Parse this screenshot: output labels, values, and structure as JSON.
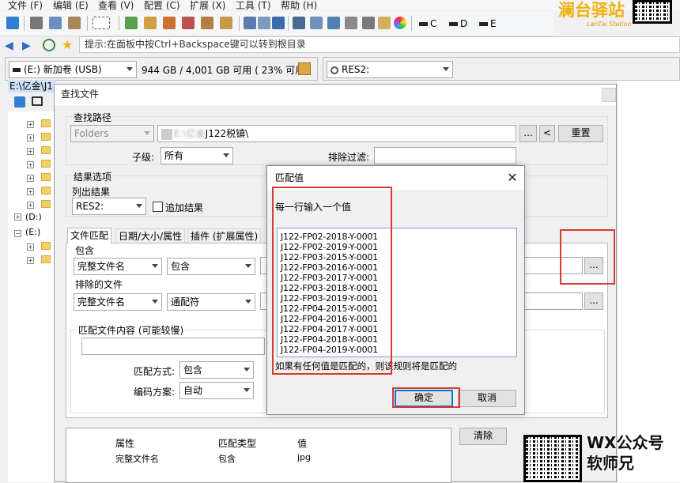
{
  "menu": {
    "items": [
      "文件 (F)",
      "编辑 (E)",
      "查看 (V)",
      "配置 (C)",
      "扩展 (X)",
      "工具 (T)",
      "帮助 (H)"
    ]
  },
  "toolbar": {
    "drives": [
      "C",
      "D",
      "E"
    ]
  },
  "logo": {
    "text": "澜台驿站",
    "sub": "LanTai Station"
  },
  "address": {
    "hint": "提示:在面板中按Ctrl+Backspace键可以转到根目录"
  },
  "left_pane": {
    "drive_combo": "(E:) 新加卷 (USB)",
    "free_space": "944 GB / 4,001 GB 可用 ( 23% 可用 )",
    "path": "E:\\亿金\\J1",
    "tree_drives": [
      "(D:)",
      "(E:)"
    ]
  },
  "right_pane": {
    "combo": "RES2:"
  },
  "find_dialog": {
    "title": "查找文件",
    "search_path_label": "查找路径",
    "folders_combo": "Folders",
    "path_value": "E:\\亿金\\J122税镇\\",
    "path_prefix_redacted": "E:\\亿金",
    "path_suffix": "J122税镇\\",
    "browse_label": "...",
    "back_label": "<",
    "reset_label": "重置",
    "sublevel_label": "子级:",
    "sublevel_value": "所有",
    "exclude_filter_label": "排除过滤:",
    "result_options_label": "结果选项",
    "list_results_label": "列出结果",
    "list_results_value": "RES2:",
    "append_results_label": "追加结果",
    "tabs": [
      "文件匹配",
      "日期/大小/属性",
      "插件 (扩展属性)"
    ],
    "include_label": "包含",
    "include_field_combo": "完整文件名",
    "include_op_combo": "包含",
    "exclude_files_label": "排除的文件",
    "exclude_field_combo": "完整文件名",
    "exclude_op_combo": "通配符",
    "content_group_label": "匹配文件内容 (可能较慢)",
    "match_mode_label": "匹配方式:",
    "match_mode_value": "包含",
    "encoding_label": "编码方案:",
    "encoding_value": "自动",
    "results_headers": [
      "属性",
      "匹配类型",
      "值"
    ],
    "results_rows": [
      [
        "完整文件名",
        "包含",
        "jpg"
      ]
    ],
    "clear_label": "清除"
  },
  "match_dialog": {
    "title": "匹配值",
    "instruction": "每一行输入一个值",
    "values": [
      "J122-FP02-2018-Y-0001",
      "J122-FP02-2019-Y-0001",
      "J122-FP03-2015-Y-0001",
      "J122-FP03-2016-Y-0001",
      "J122-FP03-2017-Y-0001",
      "J122-FP03-2018-Y-0001",
      "J122-FP03-2019-Y-0001",
      "J122-FP04-2015-Y-0001",
      "J122-FP04-2016-Y-0001",
      "J122-FP04-2017-Y-0001",
      "J122-FP04-2018-Y-0001",
      "J122-FP04-2019-Y-0001"
    ],
    "note": "如果有任何值是匹配的，则该规则将是匹配的",
    "ok_label": "确定",
    "cancel_label": "取消"
  },
  "watermark": {
    "line1": "WX公众号",
    "line2": "软师兄"
  },
  "colors": {
    "annotation_red": "#d73a31",
    "selection_blue": "#0078d7",
    "logo_gold": "#f0b010"
  }
}
